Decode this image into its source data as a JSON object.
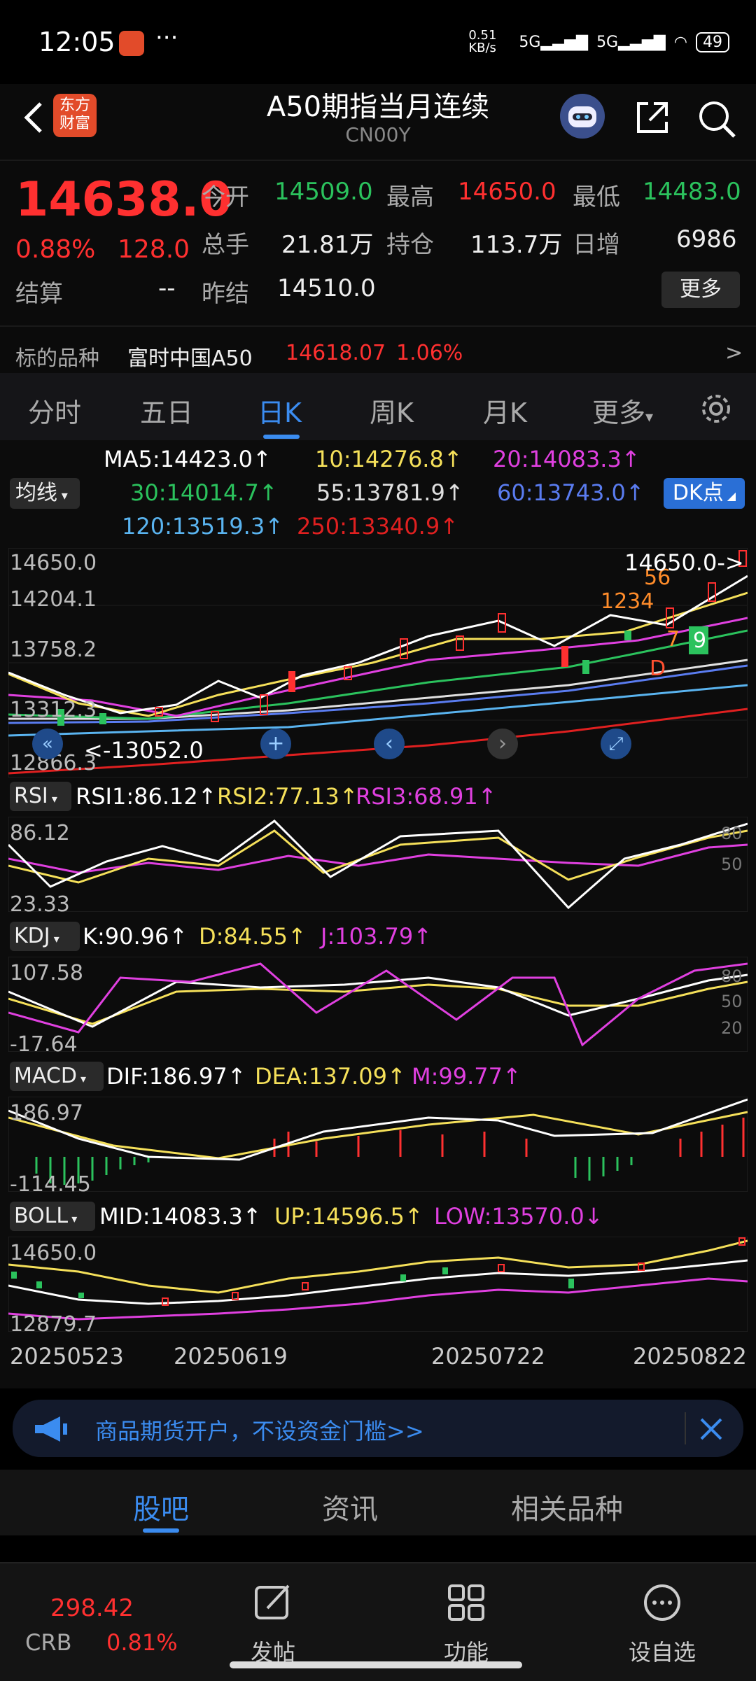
{
  "status": {
    "time": "12:05",
    "network_speed": "0.51 KB/s",
    "signal_1": "5G",
    "signal_2": "5G",
    "battery": "49"
  },
  "header": {
    "logo_text": "东方\n财富",
    "title": "A50期指当月连续",
    "subtitle": "CN00Y"
  },
  "quote": {
    "price": "14638.0",
    "change_pct": "0.88%",
    "change": "128.0",
    "fields": [
      {
        "label": "今开",
        "value": "14509.0",
        "color": "green"
      },
      {
        "label": "最高",
        "value": "14650.0",
        "color": "red"
      },
      {
        "label": "最低",
        "value": "14483.0",
        "color": "green"
      },
      {
        "label": "总手",
        "value": "21.81万",
        "color": "white"
      },
      {
        "label": "持仓",
        "value": "113.7万",
        "color": "white"
      },
      {
        "label": "日增",
        "value": "6986",
        "color": "white"
      },
      {
        "label": "结算",
        "value": "--",
        "color": "white"
      },
      {
        "label": "昨结",
        "value": "14510.0",
        "color": "white"
      }
    ],
    "more_label": "更多",
    "underlying_label": "标的品种",
    "underlying_name": "富时中国A50",
    "underlying_price": "14618.07",
    "underlying_pct": "1.06%",
    "underlying_arrow": ">"
  },
  "tabs": [
    "分时",
    "五日",
    "日K",
    "周K",
    "月K",
    "更多"
  ],
  "ma": {
    "button": "均线",
    "dk_button": "DK点",
    "ma5": "MA5:14423.0↑",
    "ma10": "10:14276.8↑",
    "ma20": "20:14083.3↑",
    "ma30": "30:14014.7↑",
    "ma55": "55:13781.9↑",
    "ma60": "60:13743.0↑",
    "ma120": "120:13519.3↑",
    "ma250": "250:13340.9↑"
  },
  "kline_axis": {
    "top": "14650.0",
    "mid1": "14204.1",
    "mid2": "13758.2",
    "mid3": "13312.3",
    "bottom": "12866.3",
    "high_marker": "14650.0->",
    "low_marker": "<-13052.0"
  },
  "markers": {
    "a": "1234",
    "b": "56",
    "c": "7",
    "d": "9",
    "e": "D",
    "f": "D"
  },
  "rsi": {
    "button": "RSI",
    "rsi1": "RSI1:86.12↑",
    "rsi2": "RSI2:77.13↑",
    "rsi3": "RSI3:68.91↑",
    "top": "86.12",
    "bottom": "23.33",
    "ref80": "80",
    "ref50": "50"
  },
  "kdj": {
    "button": "KDJ",
    "k": "K:90.96↑",
    "d": "D:84.55↑",
    "j": "J:103.79↑",
    "top": "107.58",
    "bottom": "-17.64",
    "ref80": "80",
    "ref50": "50",
    "ref20": "20"
  },
  "macd": {
    "button": "MACD",
    "dif": "DIF:186.97↑",
    "dea": "DEA:137.09↑",
    "m": "M:99.77↑",
    "top": "186.97",
    "bottom": "-114.45"
  },
  "boll": {
    "button": "BOLL",
    "mid": "MID:14083.3↑",
    "up": "UP:14596.5↑",
    "low": "LOW:13570.0↓",
    "top": "14650.0",
    "bottom": "12879.7"
  },
  "dates": [
    "20250523",
    "20250619",
    "20250722",
    "20250822"
  ],
  "banner": {
    "text": "商品期货开户，不设资金门槛>>"
  },
  "subtabs": [
    "股吧",
    "资讯",
    "相关品种"
  ],
  "bottom": {
    "crb_price": "298.42",
    "crb_label": "CRB",
    "crb_pct": "0.81%",
    "post": "发帖",
    "func": "功能",
    "watch": "设自选"
  },
  "colors": {
    "up": "#ff3030",
    "down": "#2bc25d",
    "accent": "#3b8cf0",
    "ma5": "#ffffff",
    "ma10": "#f5e05a",
    "ma20": "#e040e0",
    "ma30": "#2bc25d",
    "ma55": "#e0e0e0",
    "ma60": "#5a7cf0",
    "ma120": "#5ab4f0",
    "ma250": "#e02020"
  }
}
